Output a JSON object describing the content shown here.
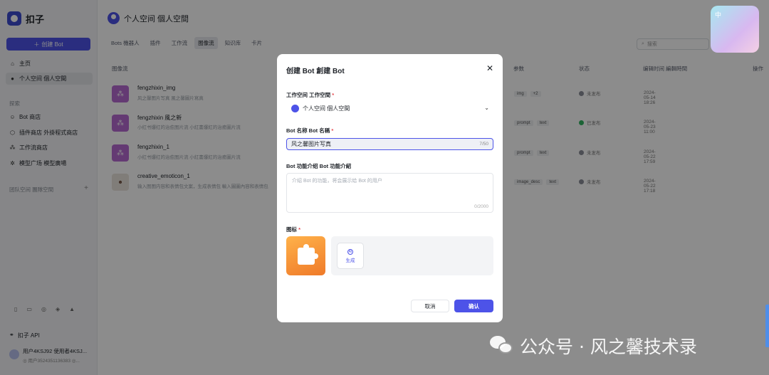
{
  "app": {
    "name": "扣子"
  },
  "sidebar": {
    "create_label": "创建 Bot",
    "nav": [
      {
        "label": "主页",
        "icon": "home-icon"
      },
      {
        "label": "个人空间 個人空間",
        "icon": "user-icon",
        "active": true
      }
    ],
    "explore_label": "探索",
    "explore": [
      {
        "label": "Bot 商店",
        "icon": "store-icon"
      },
      {
        "label": "插件商店 外掛程式商店",
        "icon": "plugin-icon"
      },
      {
        "label": "工作流商店",
        "icon": "workflow-icon"
      },
      {
        "label": "模型广场 模型廣場",
        "icon": "model-icon"
      }
    ],
    "team_label": "团队空间 團隊空間",
    "api_label": "扣子 API",
    "user_name": "用户4KSJ92 使用者4KSJ...",
    "user_id": "◎ 用户3524351136383 ◎..."
  },
  "main": {
    "space_title": "个人空间 個人空間",
    "tabs": [
      "Bots 機器人",
      "插件",
      "工作流",
      "图像流",
      "知识库",
      "卡片"
    ],
    "search_placeholder": "搜索",
    "columns": {
      "name": "图像流",
      "params": "参数",
      "status": "状态",
      "edited": "编辑时间 編輯時間",
      "actions": "操作"
    },
    "rows": [
      {
        "name": "fengzhixin_img",
        "desc": "风之馨图片写真 風之馨圖片寫真",
        "chips": [
          "img",
          "+2"
        ],
        "status": "未发布",
        "published": false,
        "edited": "2024-05-14 18:26"
      },
      {
        "name": "fengzhixin 風之新",
        "desc": "小红书爆红的治愈图片流 小紅書爆紅的治癒圖片流",
        "chips": [
          "prompt",
          "text"
        ],
        "status": "已发布",
        "published": true,
        "edited": "2024-05-23 11:00"
      },
      {
        "name": "fengzhixin_1",
        "desc": "小红书爆红的治愈图片流 小紅書爆紅的治癒圖片流",
        "chips": [
          "prompt",
          "text"
        ],
        "status": "未发布",
        "published": false,
        "edited": "2024-05-22 17:59"
      },
      {
        "name": "creative_emoticon_1",
        "desc": "输入图图内容和表情包文案，生成表情包 輸入圖圖內容和表情包",
        "chips": [
          "image_desc",
          "text"
        ],
        "status": "未发布",
        "published": false,
        "edited": "2024-05-22 17:18"
      }
    ]
  },
  "modal": {
    "title": "创建 Bot 創建 Bot",
    "workspace_label": "工作空间 工作空間",
    "workspace_value": "个人空间 個人空間",
    "name_label": "Bot 名称 Bot 名稱",
    "name_value": "风之馨图片写真",
    "name_count": "7/50",
    "desc_label": "Bot 功能介绍 Bot 功能介紹",
    "desc_placeholder": "介绍 Bot 的功能，将会展示给 Bot 的用户",
    "desc_count": "0/2000",
    "icon_label": "图标",
    "generate_label": "生成",
    "cancel_label": "取消",
    "confirm_label": "确认"
  },
  "overlays": {
    "watermark_text": "公众号 · 风之馨技术录",
    "sticker_text": "中"
  },
  "colors": {
    "accent": "#4d53e8",
    "required": "#e5484d",
    "published": "#33b463"
  }
}
